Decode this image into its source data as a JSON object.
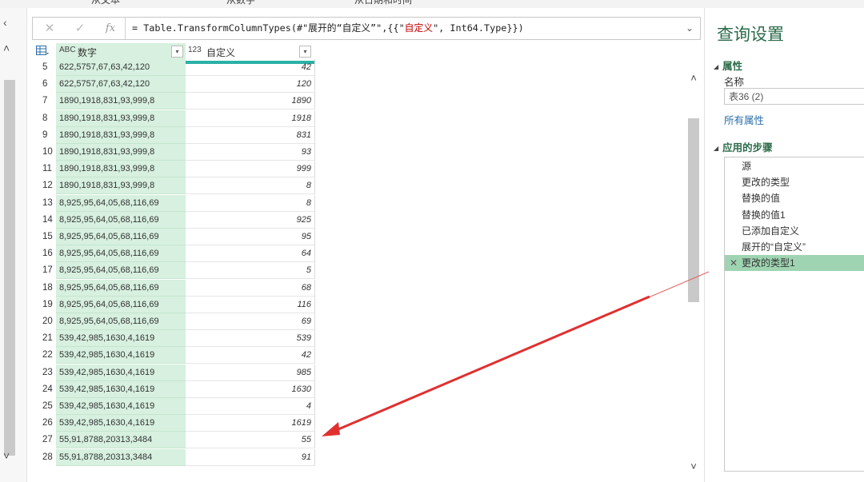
{
  "ribbon": {
    "tabs": [
      "从文本",
      "从数字",
      "从日期和时间"
    ]
  },
  "formula_bar": {
    "cancel_icon": "✕",
    "commit_icon": "✓",
    "fx_label": "fx",
    "formula_prefix": "= Table.TransformColumnTypes(#\"展开的“自定义”\",{{\"",
    "formula_column": "自定义",
    "formula_suffix": "\", Int64.Type}})"
  },
  "grid": {
    "columns": [
      {
        "type_icon": "ABC",
        "label": "数字"
      },
      {
        "type_icon": "123",
        "label": "自定义"
      }
    ],
    "rows": [
      {
        "n": "5",
        "text": "622,5757,67,63,42,120",
        "value": "42"
      },
      {
        "n": "6",
        "text": "622,5757,67,63,42,120",
        "value": "120"
      },
      {
        "n": "7",
        "text": "1890,1918,831,93,999,8",
        "value": "1890"
      },
      {
        "n": "8",
        "text": "1890,1918,831,93,999,8",
        "value": "1918"
      },
      {
        "n": "9",
        "text": "1890,1918,831,93,999,8",
        "value": "831"
      },
      {
        "n": "10",
        "text": "1890,1918,831,93,999,8",
        "value": "93"
      },
      {
        "n": "11",
        "text": "1890,1918,831,93,999,8",
        "value": "999"
      },
      {
        "n": "12",
        "text": "1890,1918,831,93,999,8",
        "value": "8"
      },
      {
        "n": "13",
        "text": "8,925,95,64,05,68,116,69",
        "value": "8"
      },
      {
        "n": "14",
        "text": "8,925,95,64,05,68,116,69",
        "value": "925"
      },
      {
        "n": "15",
        "text": "8,925,95,64,05,68,116,69",
        "value": "95"
      },
      {
        "n": "16",
        "text": "8,925,95,64,05,68,116,69",
        "value": "64"
      },
      {
        "n": "17",
        "text": "8,925,95,64,05,68,116,69",
        "value": "5"
      },
      {
        "n": "18",
        "text": "8,925,95,64,05,68,116,69",
        "value": "68"
      },
      {
        "n": "19",
        "text": "8,925,95,64,05,68,116,69",
        "value": "116"
      },
      {
        "n": "20",
        "text": "8,925,95,64,05,68,116,69",
        "value": "69"
      },
      {
        "n": "21",
        "text": "539,42,985,1630,4,1619",
        "value": "539"
      },
      {
        "n": "22",
        "text": "539,42,985,1630,4,1619",
        "value": "42"
      },
      {
        "n": "23",
        "text": "539,42,985,1630,4,1619",
        "value": "985"
      },
      {
        "n": "24",
        "text": "539,42,985,1630,4,1619",
        "value": "1630"
      },
      {
        "n": "25",
        "text": "539,42,985,1630,4,1619",
        "value": "4"
      },
      {
        "n": "26",
        "text": "539,42,985,1630,4,1619",
        "value": "1619"
      },
      {
        "n": "27",
        "text": "55,91,8788,20313,3484",
        "value": "55"
      },
      {
        "n": "28",
        "text": "55,91,8788,20313,3484",
        "value": "91"
      }
    ]
  },
  "settings": {
    "title": "查询设置",
    "properties_header": "属性",
    "name_label": "名称",
    "name_value": "表36 (2)",
    "all_properties_link": "所有属性",
    "steps_header": "应用的步骤",
    "steps": [
      "源",
      "更改的类型",
      "替换的值",
      "替换的值1",
      "已添加自定义",
      "展开的“自定义”",
      "更改的类型1"
    ],
    "selected_step_delete_icon": "✕"
  },
  "colors": {
    "accent_green": "#2b6b49",
    "selected_column": "#d7f0df",
    "selected_step": "#9fd4b2",
    "header_underline": "#2ab1a7",
    "arrow": "#e03030"
  }
}
